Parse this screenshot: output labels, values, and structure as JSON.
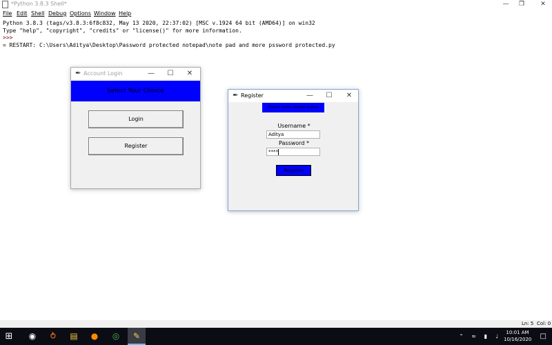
{
  "shell": {
    "title": "*Python 3.8.3 Shell*",
    "menu": [
      "File",
      "Edit",
      "Shell",
      "Debug",
      "Options",
      "Window",
      "Help"
    ],
    "lines": [
      "Python 3.8.3 (tags/v3.8.3:6f8c832, May 13 2020, 22:37:02) [MSC v.1924 64 bit (AMD64)] on win32",
      "Type \"help\", \"copyright\", \"credits\" or \"license()\" for more information.",
      ">>> ",
      "= RESTART: C:\\Users\\Aditya\\Desktop\\Password protected notepad\\note pad and more pssword protected.py"
    ],
    "status_line": "Ln: 5",
    "status_col": "Col: 0"
  },
  "login_window": {
    "title": "Account Login",
    "banner": "Select Your Choice",
    "login_label": "Login",
    "register_label": "Register"
  },
  "register_window": {
    "title": "Register",
    "banner": "Please enter details below",
    "username_label": "Username *",
    "username_value": "Aditya",
    "password_label": "Password * ",
    "password_value": "****",
    "submit_label": "Register"
  },
  "taskbar": {
    "time": "10:01 AM",
    "date": "10/16/2020",
    "apps": [
      "search-icon",
      "snipping-tool-icon",
      "file-explorer-icon",
      "firefox-icon",
      "chrome-icon",
      "idle-python-icon"
    ]
  },
  "colors": {
    "banner_blue": "#0000ff",
    "taskbar": "#0c0c14"
  }
}
